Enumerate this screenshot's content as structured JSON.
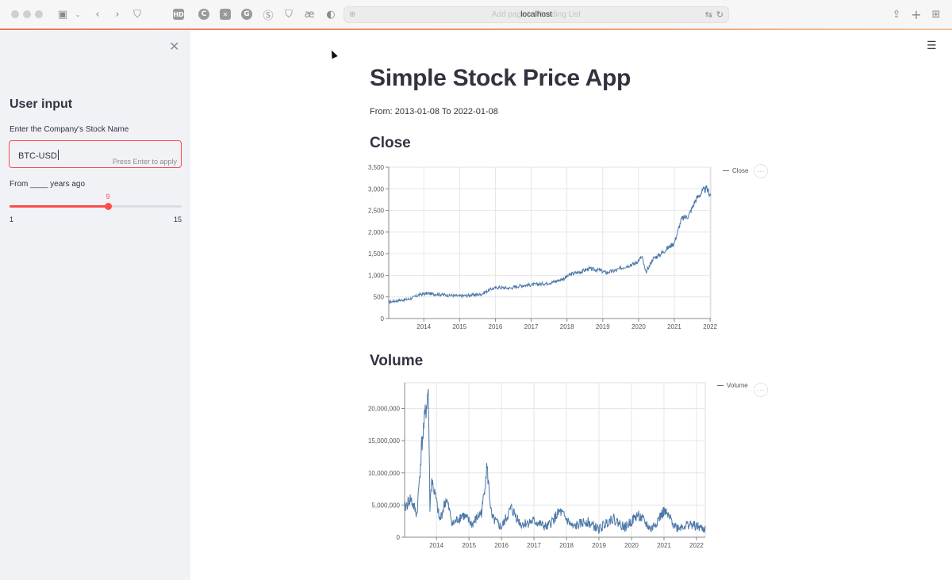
{
  "browser": {
    "url": "localhost",
    "url_ghost": "Add page to Reading List"
  },
  "sidebar": {
    "title": "User input",
    "stock_label": "Enter the Company's Stock Name",
    "stock_value": "BTC-USD",
    "stock_hint": "Press Enter to apply",
    "years_label": "From ____ years ago",
    "slider": {
      "min": 1,
      "max": 15,
      "value": 9,
      "min_label": "1",
      "max_label": "15",
      "value_label": "9"
    }
  },
  "main": {
    "title": "Simple Stock Price App",
    "date_range": "From: 2013-01-08 To 2022-01-08",
    "close_heading": "Close",
    "volume_heading": "Volume",
    "more_label": "···"
  },
  "colors": {
    "accent": "#ff4b4b",
    "series": "#4c78a8",
    "sidebar_bg": "#f0f2f6"
  },
  "chart_data": [
    {
      "type": "line",
      "series_name": "Close",
      "legend": "Close",
      "ylim": [
        0,
        3500
      ],
      "y_ticks": [
        "0",
        "500",
        "1,000",
        "1,500",
        "2,000",
        "2,500",
        "3,000",
        "3,500"
      ],
      "y_tick_values": [
        0,
        500,
        1000,
        1500,
        2000,
        2500,
        3000,
        3500
      ],
      "xlim": [
        2013.02,
        2022.02
      ],
      "x_ticks": [
        "2014",
        "2015",
        "2016",
        "2017",
        "2018",
        "2019",
        "2020",
        "2021",
        "2022"
      ],
      "x_tick_values": [
        2014,
        2015,
        2016,
        2017,
        2018,
        2019,
        2020,
        2021,
        2022
      ],
      "x": [
        2013.02,
        2013.3,
        2013.6,
        2013.9,
        2014.1,
        2014.4,
        2014.7,
        2015.0,
        2015.3,
        2015.6,
        2015.9,
        2016.1,
        2016.4,
        2016.7,
        2017.0,
        2017.3,
        2017.6,
        2017.9,
        2018.1,
        2018.4,
        2018.6,
        2018.9,
        2019.1,
        2019.4,
        2019.6,
        2019.9,
        2020.1,
        2020.2,
        2020.4,
        2020.6,
        2020.8,
        2021.0,
        2021.2,
        2021.4,
        2021.6,
        2021.8,
        2021.9,
        2022.02
      ],
      "y": [
        380,
        420,
        450,
        560,
        580,
        560,
        540,
        520,
        540,
        560,
        690,
        720,
        700,
        760,
        780,
        800,
        840,
        920,
        1020,
        1090,
        1150,
        1120,
        1060,
        1120,
        1200,
        1270,
        1430,
        1050,
        1380,
        1480,
        1620,
        1750,
        2300,
        2380,
        2750,
        2950,
        3000,
        2850
      ]
    },
    {
      "type": "line",
      "series_name": "Volume",
      "legend": "Volume",
      "ylim": [
        0,
        24000000
      ],
      "y_ticks": [
        "0",
        "5,000,000",
        "10,000,000",
        "15,000,000",
        "20,000,000"
      ],
      "y_tick_values": [
        0,
        5000000,
        10000000,
        15000000,
        20000000
      ],
      "xlim": [
        2013.02,
        2022.27
      ],
      "x_ticks": [
        "2014",
        "2015",
        "2016",
        "2017",
        "2018",
        "2019",
        "2020",
        "2021",
        "2022"
      ],
      "x_tick_values": [
        2014,
        2015,
        2016,
        2017,
        2018,
        2019,
        2020,
        2021,
        2022
      ],
      "x": [
        2013.02,
        2013.2,
        2013.4,
        2013.55,
        2013.75,
        2013.8,
        2013.85,
        2014.0,
        2014.1,
        2014.3,
        2014.5,
        2014.8,
        2015.1,
        2015.4,
        2015.55,
        2015.7,
        2016.0,
        2016.3,
        2016.6,
        2017.0,
        2017.4,
        2017.8,
        2018.2,
        2018.6,
        2019.0,
        2019.4,
        2019.8,
        2020.2,
        2020.6,
        2021.0,
        2021.4,
        2021.8,
        2022.27
      ],
      "y": [
        4500000,
        6000000,
        3500000,
        14500000,
        23000000,
        4500000,
        9000000,
        5500000,
        2500000,
        6000000,
        2000000,
        3500000,
        2000000,
        4000000,
        11000000,
        3000000,
        1500000,
        4500000,
        2000000,
        2500000,
        1500000,
        4000000,
        1500000,
        2500000,
        1200000,
        3000000,
        1500000,
        3500000,
        1200000,
        4000000,
        1500000,
        2000000,
        1200000
      ]
    }
  ]
}
